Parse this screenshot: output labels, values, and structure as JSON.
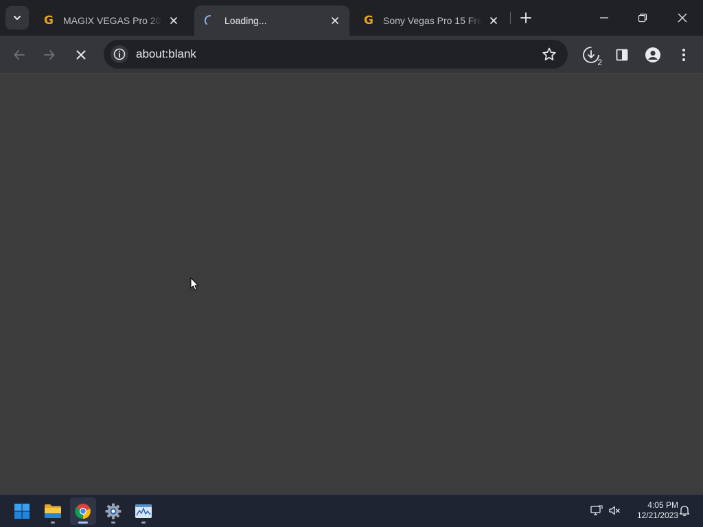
{
  "browser": {
    "tabs": [
      {
        "title": "MAGIX VEGAS Pro 20",
        "favicon": "g-favicon",
        "active": false
      },
      {
        "title": "Loading...",
        "favicon": "loading-spinner",
        "active": true
      },
      {
        "title": "Sony Vegas Pro 15 Free",
        "favicon": "g-favicon",
        "active": false
      }
    ],
    "omnibox": {
      "url": "about:blank"
    },
    "downloads": {
      "count": "2"
    }
  },
  "taskbar": {
    "apps": [
      "windows-start",
      "file-explorer",
      "chrome",
      "settings",
      "task-manager"
    ],
    "clock": {
      "time": "4:05 PM",
      "date": "12/21/2023"
    }
  },
  "colors": {
    "tabstrip": "#202124",
    "toolbar": "#35363a",
    "omnibox": "#202124",
    "page": "#3c3c3c",
    "taskbar": "#1f2433",
    "favicon_accent": "#e8a31b"
  }
}
